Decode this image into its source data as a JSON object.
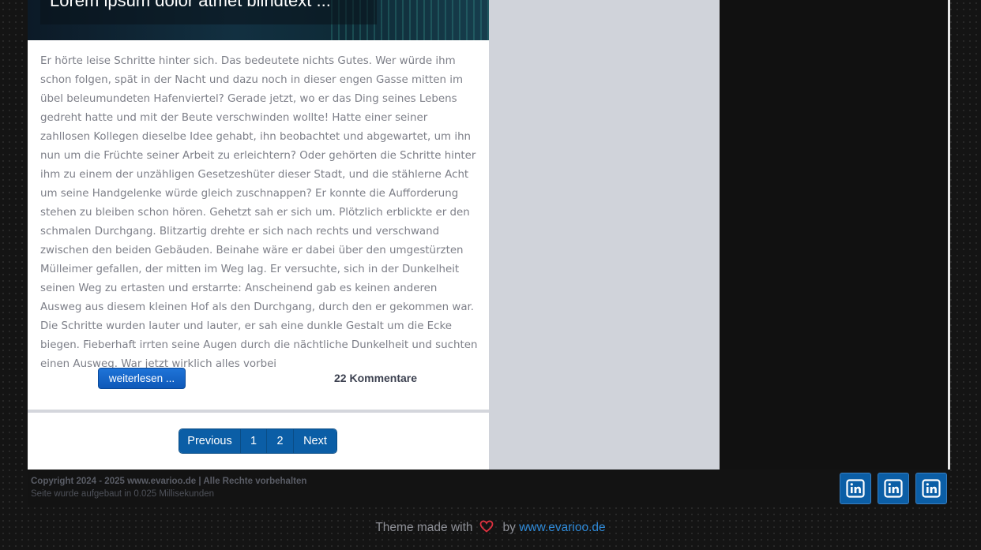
{
  "article": {
    "title": "Lorem ipsum dolor atmet blindtext ...",
    "body": "Er hörte leise Schritte hinter sich. Das bedeutete nichts Gutes. Wer würde ihm schon folgen, spät in der Nacht und dazu noch in dieser engen Gasse mitten im übel beleumundeten Hafenviertel? Gerade jetzt, wo er das Ding seines Lebens gedreht hatte und mit der Beute verschwinden wollte! Hatte einer seiner zahllosen Kollegen dieselbe Idee gehabt, ihn beobachtet und abgewartet, um ihn nun um die Früchte seiner Arbeit zu erleichtern? Oder gehörten die Schritte hinter ihm zu einem der unzähligen Gesetzeshüter dieser Stadt, und die stählerne Acht um seine Handgelenke würde gleich zuschnappen? Er konnte die Aufforderung stehen zu bleiben schon hören. Gehetzt sah er sich um. Plötzlich erblickte er den schmalen Durchgang. Blitzartig drehte er sich nach rechts und verschwand zwischen den beiden Gebäuden. Beinahe wäre er dabei über den umgestürzten Mülleimer gefallen, der mitten im Weg lag. Er versuchte, sich in der Dunkelheit seinen Weg zu ertasten und erstarrte: Anscheinend gab es keinen anderen Ausweg aus diesem kleinen Hof als den Durchgang, durch den er gekommen war. Die Schritte wurden lauter und lauter, er sah eine dunkle Gestalt um die Ecke biegen. Fieberhaft irrten seine Augen durch die nächtliche Dunkelheit und suchten einen Ausweg. War jetzt wirklich alles vorbei",
    "read_more_label": "weiterlesen ...",
    "comments_label": "22 Kommentare"
  },
  "pagination": {
    "previous": "Previous",
    "page1": "1",
    "page2": "2",
    "next": "Next"
  },
  "footer": {
    "copyright": "Copyright 2024 - 2025 www.evarioo.de | Alle Rechte vorbehalten",
    "build_time": "Seite wurde aufgebaut in 0.025 Millisekunden",
    "social_icons": [
      "linkedin-icon",
      "linkedin-icon",
      "linkedin-icon"
    ],
    "theme_prefix": "Theme made with",
    "theme_by": "by",
    "theme_link": "www.evarioo.de"
  },
  "colors": {
    "accent": "#0b5ea6",
    "heart": "#e0313f",
    "link": "#2f8ad8"
  }
}
